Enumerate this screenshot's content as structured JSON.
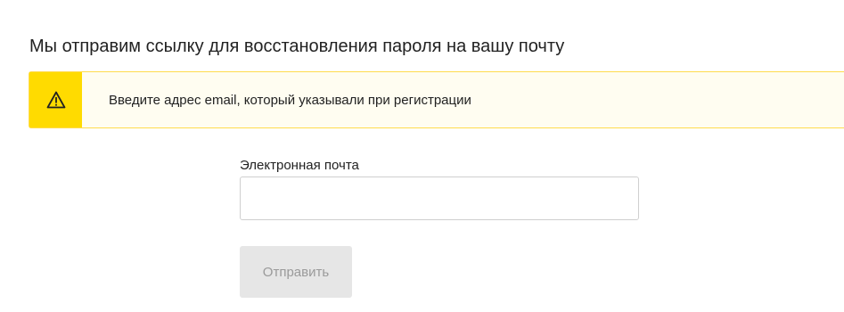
{
  "page": {
    "heading": "Мы отправим ссылку для восстановления пароля на вашу почту"
  },
  "notice": {
    "icon": "warning-triangle-icon",
    "text": "Введите адрес email, который указывали при регистрации",
    "icon_bg_color": "#ffdb00",
    "border_color": "#ffdb4d"
  },
  "form": {
    "email_label": "Электронная почта",
    "email_value": "",
    "email_placeholder": "",
    "submit_label": "Отправить",
    "submit_disabled": true
  }
}
